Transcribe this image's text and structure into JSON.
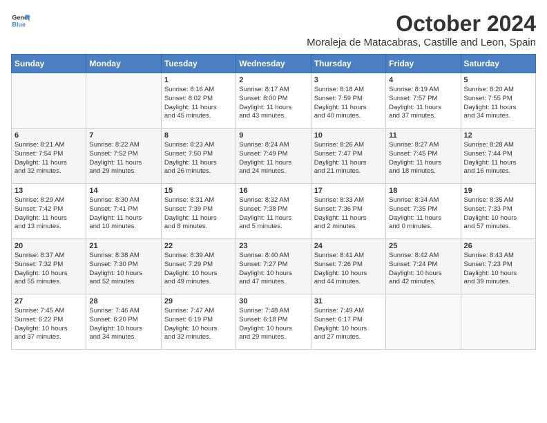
{
  "logo": {
    "line1": "General",
    "line2": "Blue"
  },
  "title": "October 2024",
  "subtitle": "Moraleja de Matacabras, Castille and Leon, Spain",
  "days_of_week": [
    "Sunday",
    "Monday",
    "Tuesday",
    "Wednesday",
    "Thursday",
    "Friday",
    "Saturday"
  ],
  "weeks": [
    [
      {
        "day": "",
        "text": ""
      },
      {
        "day": "",
        "text": ""
      },
      {
        "day": "1",
        "text": "Sunrise: 8:16 AM\nSunset: 8:02 PM\nDaylight: 11 hours\nand 45 minutes."
      },
      {
        "day": "2",
        "text": "Sunrise: 8:17 AM\nSunset: 8:00 PM\nDaylight: 11 hours\nand 43 minutes."
      },
      {
        "day": "3",
        "text": "Sunrise: 8:18 AM\nSunset: 7:59 PM\nDaylight: 11 hours\nand 40 minutes."
      },
      {
        "day": "4",
        "text": "Sunrise: 8:19 AM\nSunset: 7:57 PM\nDaylight: 11 hours\nand 37 minutes."
      },
      {
        "day": "5",
        "text": "Sunrise: 8:20 AM\nSunset: 7:55 PM\nDaylight: 11 hours\nand 34 minutes."
      }
    ],
    [
      {
        "day": "6",
        "text": "Sunrise: 8:21 AM\nSunset: 7:54 PM\nDaylight: 11 hours\nand 32 minutes."
      },
      {
        "day": "7",
        "text": "Sunrise: 8:22 AM\nSunset: 7:52 PM\nDaylight: 11 hours\nand 29 minutes."
      },
      {
        "day": "8",
        "text": "Sunrise: 8:23 AM\nSunset: 7:50 PM\nDaylight: 11 hours\nand 26 minutes."
      },
      {
        "day": "9",
        "text": "Sunrise: 8:24 AM\nSunset: 7:49 PM\nDaylight: 11 hours\nand 24 minutes."
      },
      {
        "day": "10",
        "text": "Sunrise: 8:26 AM\nSunset: 7:47 PM\nDaylight: 11 hours\nand 21 minutes."
      },
      {
        "day": "11",
        "text": "Sunrise: 8:27 AM\nSunset: 7:45 PM\nDaylight: 11 hours\nand 18 minutes."
      },
      {
        "day": "12",
        "text": "Sunrise: 8:28 AM\nSunset: 7:44 PM\nDaylight: 11 hours\nand 16 minutes."
      }
    ],
    [
      {
        "day": "13",
        "text": "Sunrise: 8:29 AM\nSunset: 7:42 PM\nDaylight: 11 hours\nand 13 minutes."
      },
      {
        "day": "14",
        "text": "Sunrise: 8:30 AM\nSunset: 7:41 PM\nDaylight: 11 hours\nand 10 minutes."
      },
      {
        "day": "15",
        "text": "Sunrise: 8:31 AM\nSunset: 7:39 PM\nDaylight: 11 hours\nand 8 minutes."
      },
      {
        "day": "16",
        "text": "Sunrise: 8:32 AM\nSunset: 7:38 PM\nDaylight: 11 hours\nand 5 minutes."
      },
      {
        "day": "17",
        "text": "Sunrise: 8:33 AM\nSunset: 7:36 PM\nDaylight: 11 hours\nand 2 minutes."
      },
      {
        "day": "18",
        "text": "Sunrise: 8:34 AM\nSunset: 7:35 PM\nDaylight: 11 hours\nand 0 minutes."
      },
      {
        "day": "19",
        "text": "Sunrise: 8:35 AM\nSunset: 7:33 PM\nDaylight: 10 hours\nand 57 minutes."
      }
    ],
    [
      {
        "day": "20",
        "text": "Sunrise: 8:37 AM\nSunset: 7:32 PM\nDaylight: 10 hours\nand 55 minutes."
      },
      {
        "day": "21",
        "text": "Sunrise: 8:38 AM\nSunset: 7:30 PM\nDaylight: 10 hours\nand 52 minutes."
      },
      {
        "day": "22",
        "text": "Sunrise: 8:39 AM\nSunset: 7:29 PM\nDaylight: 10 hours\nand 49 minutes."
      },
      {
        "day": "23",
        "text": "Sunrise: 8:40 AM\nSunset: 7:27 PM\nDaylight: 10 hours\nand 47 minutes."
      },
      {
        "day": "24",
        "text": "Sunrise: 8:41 AM\nSunset: 7:26 PM\nDaylight: 10 hours\nand 44 minutes."
      },
      {
        "day": "25",
        "text": "Sunrise: 8:42 AM\nSunset: 7:24 PM\nDaylight: 10 hours\nand 42 minutes."
      },
      {
        "day": "26",
        "text": "Sunrise: 8:43 AM\nSunset: 7:23 PM\nDaylight: 10 hours\nand 39 minutes."
      }
    ],
    [
      {
        "day": "27",
        "text": "Sunrise: 7:45 AM\nSunset: 6:22 PM\nDaylight: 10 hours\nand 37 minutes."
      },
      {
        "day": "28",
        "text": "Sunrise: 7:46 AM\nSunset: 6:20 PM\nDaylight: 10 hours\nand 34 minutes."
      },
      {
        "day": "29",
        "text": "Sunrise: 7:47 AM\nSunset: 6:19 PM\nDaylight: 10 hours\nand 32 minutes."
      },
      {
        "day": "30",
        "text": "Sunrise: 7:48 AM\nSunset: 6:18 PM\nDaylight: 10 hours\nand 29 minutes."
      },
      {
        "day": "31",
        "text": "Sunrise: 7:49 AM\nSunset: 6:17 PM\nDaylight: 10 hours\nand 27 minutes."
      },
      {
        "day": "",
        "text": ""
      },
      {
        "day": "",
        "text": ""
      }
    ]
  ]
}
